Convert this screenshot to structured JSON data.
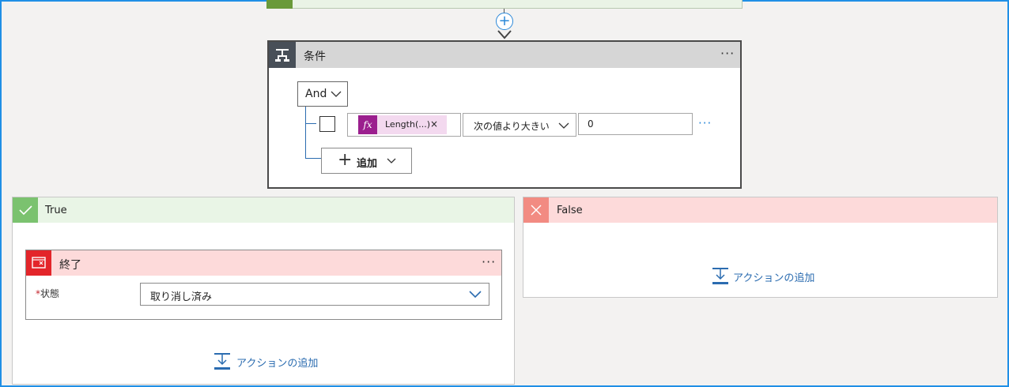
{
  "condition": {
    "title": "条件",
    "more": "···",
    "group_operator": "And",
    "row": {
      "expression_token": "Length(...)",
      "token_remove": "×",
      "function_icon": "fx",
      "operator": "次の値より大きい",
      "value": "0",
      "more": "···"
    },
    "add_label": "追加"
  },
  "true_branch": {
    "label": "True",
    "terminate": {
      "title": "終了",
      "more": "···",
      "status_label": "状態",
      "required_mark": "*",
      "status_value": "取り消し済み"
    },
    "add_action": "アクションの追加"
  },
  "false_branch": {
    "label": "False",
    "add_action": "アクションの追加"
  },
  "colors": {
    "accent": "#2b88d8",
    "true_green": "#7bc26f",
    "false_red": "#f28b82",
    "terminate_red": "#e3252a",
    "function_purple": "#9b1f8e"
  }
}
